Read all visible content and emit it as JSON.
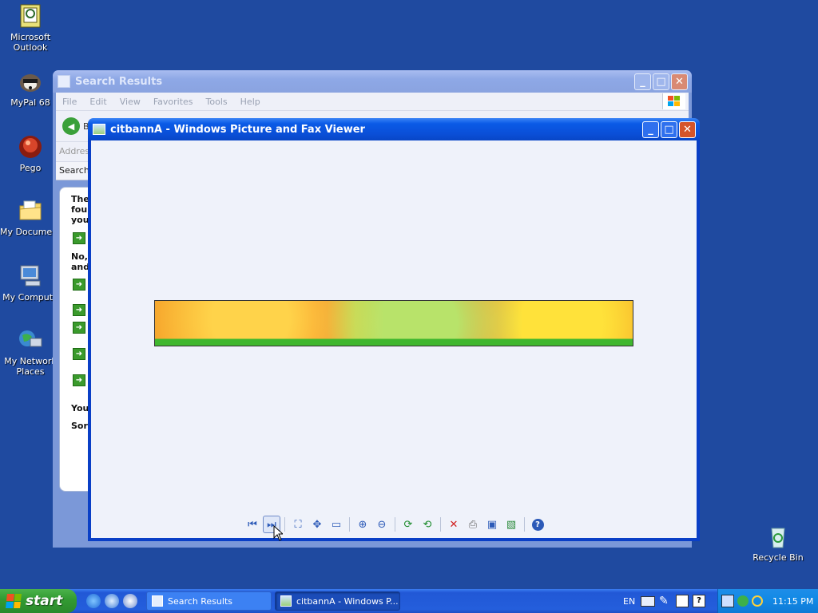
{
  "desktop": {
    "icons": [
      {
        "label": "Microsoft\nOutlook",
        "name": "outlook"
      },
      {
        "label": "MyPal 68",
        "name": "mypal"
      },
      {
        "label": "Pego",
        "name": "pego"
      },
      {
        "label": "My Document",
        "name": "my-documents"
      },
      {
        "label": "My Compute",
        "name": "my-computer"
      },
      {
        "label": "My Network\nPlaces",
        "name": "my-network-places"
      },
      {
        "label": "Recycle Bin",
        "name": "recycle-bin"
      }
    ]
  },
  "search_window": {
    "title": "Search Results",
    "menu": [
      "File",
      "Edit",
      "View",
      "Favorites",
      "Tools",
      "Help"
    ],
    "back_label": "B",
    "address_label": "Addres",
    "search_label": "Search",
    "panel_text_1": [
      "The",
      "foun",
      "you"
    ],
    "panel_text_2": [
      "No,",
      "and"
    ],
    "panel_text_3": "You",
    "panel_text_4": "Sor"
  },
  "viewer_window": {
    "title": "citbannA - Windows Picture and Fax Viewer"
  },
  "taskbar": {
    "start_label": "start",
    "tasks": [
      {
        "label": "Search Results"
      },
      {
        "label": "citbannA - Windows P..."
      }
    ],
    "language": "EN",
    "clock": "11:15 PM"
  },
  "colors": {
    "desktop": "#1f4aa0",
    "active_title": "#0a4fd8",
    "start_green": "#339c33"
  }
}
